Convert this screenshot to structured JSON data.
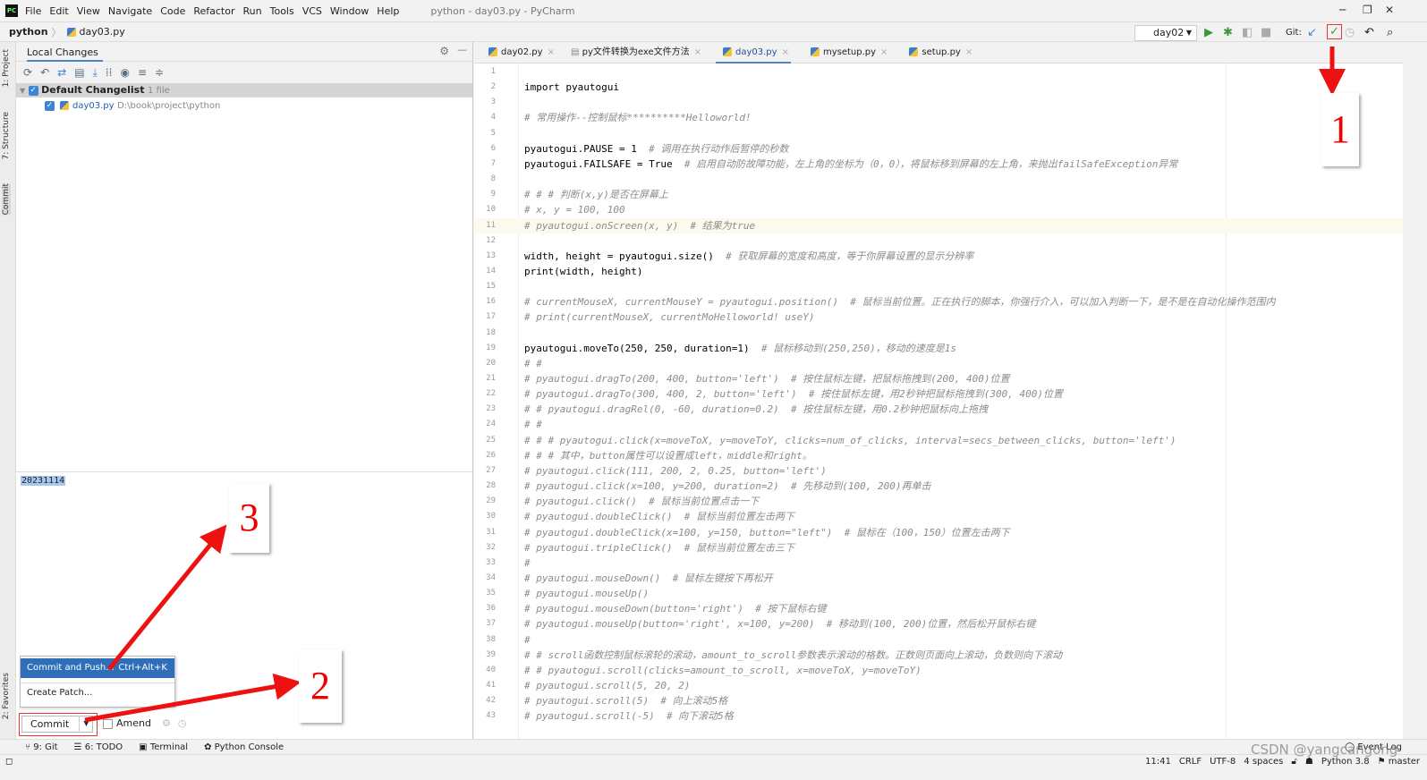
{
  "titlebar": {
    "menus": [
      "File",
      "Edit",
      "View",
      "Navigate",
      "Code",
      "Refactor",
      "Run",
      "Tools",
      "VCS",
      "Window",
      "Help"
    ],
    "title": "python - day03.py - PyCharm"
  },
  "navbar": {
    "project": "python",
    "file": "day03.py"
  },
  "toolbar": {
    "run_config": "day02",
    "git_label": "Git:"
  },
  "left_stripe": {
    "project": "1: Project",
    "structure": "7: Structure",
    "commit": "Commit",
    "favorites": "2: Favorites"
  },
  "local_changes": {
    "tab": "Local Changes",
    "changelist": "Default Changelist",
    "changelist_count": "1 file",
    "file": "day03.py",
    "file_path": "D:\\book\\project\\python",
    "commit_message": "20231114"
  },
  "commit_popup": {
    "items": [
      {
        "label": "Commit and Push...",
        "shortcut": "Ctrl+Alt+K"
      },
      {
        "label": "Create Patch...",
        "shortcut": ""
      }
    ]
  },
  "commit_bar": {
    "commit_label": "Commit",
    "amend_label": "Amend"
  },
  "editor_tabs": [
    {
      "label": "day02.py"
    },
    {
      "label": "py文件转换为exe文件方法"
    },
    {
      "label": "day03.py",
      "active": true
    },
    {
      "label": "mysetup.py"
    },
    {
      "label": "setup.py"
    }
  ],
  "code_lines": [
    "",
    "import pyautogui",
    "",
    "# 常用操作--控制鼠标**********Helloworld!",
    "",
    "pyautogui.PAUSE = 1  # 调用在执行动作后暂停的秒数",
    "pyautogui.FAILSAFE = True  # 启用自动防故障功能，左上角的坐标为（0，0），将鼠标移到屏幕的左上角，来抛出failSafeException异常",
    "",
    "# # # 判断(x,y)是否在屏幕上",
    "# x, y = 100, 100",
    "# pyautogui.onScreen(x, y)  # 结果为true",
    "",
    "width, height = pyautogui.size()  # 获取屏幕的宽度和高度，等于你屏幕设置的显示分辨率",
    "print(width, height)",
    "",
    "# currentMouseX, currentMouseY = pyautogui.position()  # 鼠标当前位置。正在执行的脚本，你强行介入，可以加入判断一下，是不是在自动化操作范围内",
    "# print(currentMouseX, currentMoHelloworld! useY)",
    "",
    "pyautogui.moveTo(250, 250, duration=1)  # 鼠标移动到(250,250)，移动的速度是1s",
    "# #",
    "# pyautogui.dragTo(200, 400, button='left')  # 按住鼠标左键，把鼠标拖拽到(200, 400)位置",
    "# pyautogui.dragTo(300, 400, 2, button='left')  # 按住鼠标左键，用2秒钟把鼠标拖拽到(300, 400)位置",
    "# # pyautogui.dragRel(0, -60, duration=0.2)  # 按住鼠标左键，用0.2秒钟把鼠标向上拖拽",
    "# #",
    "# # # pyautogui.click(x=moveToX, y=moveToY, clicks=num_of_clicks, interval=secs_between_clicks, button='left')",
    "# # # 其中，button属性可以设置成left，middle和right。",
    "# pyautogui.click(111, 200, 2, 0.25, button='left')",
    "# pyautogui.click(x=100, y=200, duration=2)  # 先移动到(100, 200)再单击",
    "# pyautogui.click()  # 鼠标当前位置点击一下",
    "# pyautogui.doubleClick()  # 鼠标当前位置左击两下",
    "# pyautogui.doubleClick(x=100, y=150, button=\"left\")  # 鼠标在（100，150）位置左击两下",
    "# pyautogui.tripleClick()  # 鼠标当前位置左击三下",
    "#",
    "# pyautogui.mouseDown()  # 鼠标左键按下再松开",
    "# pyautogui.mouseUp()",
    "# pyautogui.mouseDown(button='right')  # 按下鼠标右键",
    "# pyautogui.mouseUp(button='right', x=100, y=200)  # 移动到(100, 200)位置，然后松开鼠标右键",
    "#",
    "# # scroll函数控制鼠标滚轮的滚动，amount_to_scroll参数表示滚动的格数。正数则页面向上滚动，负数则向下滚动",
    "# # pyautogui.scroll(clicks=amount_to_scroll, x=moveToX, y=moveToY)",
    "# pyautogui.scroll(5, 20, 2)",
    "# pyautogui.scroll(5)  # 向上滚动5格",
    "# pyautogui.scroll(-5)  # 向下滚动5格"
  ],
  "current_line": 11,
  "bottom_tools": [
    "9: Git",
    "6: TODO",
    "Terminal",
    "Python Console"
  ],
  "status": {
    "position": "11:41",
    "line_sep": "CRLF",
    "encoding": "UTF-8",
    "indent": "4 spaces",
    "interpreter": "Python 3.8",
    "branch": "master",
    "event_log": "Event Log"
  },
  "watermark": "CSDN @yangcangong",
  "annotations": {
    "n1": "1",
    "n2": "2",
    "n3": "3",
    "color": "#ee1111"
  }
}
